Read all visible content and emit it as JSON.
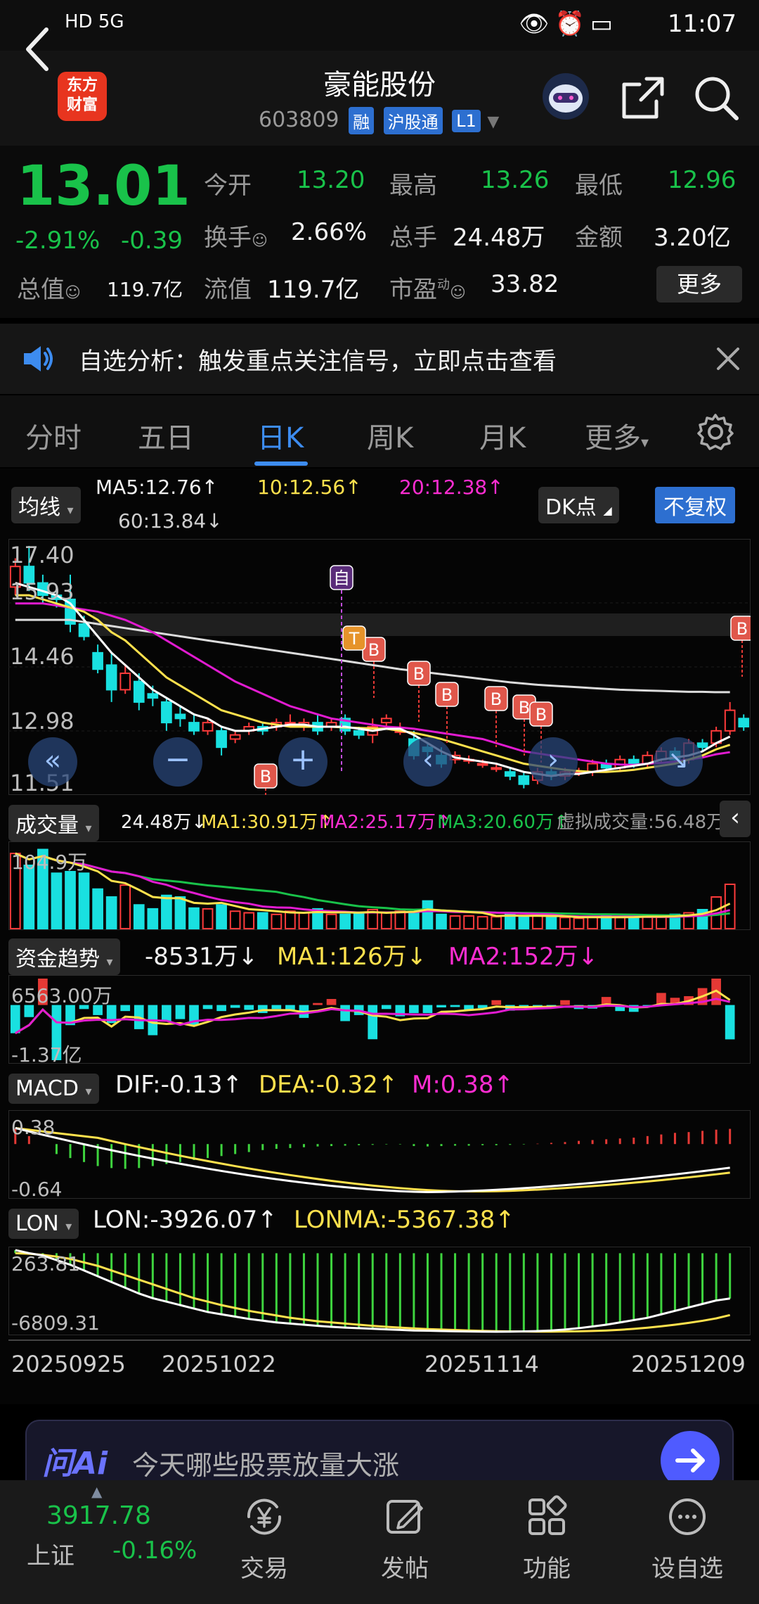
{
  "status_bar": {
    "left": "HD 5G",
    "time": "11:07"
  },
  "header": {
    "logo_line1": "东方",
    "logo_line2": "财富",
    "stock_name": "豪能股份",
    "stock_code": "603809",
    "tag_margin": "融",
    "tag_connect": "沪股通",
    "tag_level": "L1"
  },
  "quote": {
    "price": "13.01",
    "change_pct": "-2.91%",
    "change_amt": "-0.39",
    "open_label": "今开",
    "open": "13.20",
    "high_label": "最高",
    "high": "13.26",
    "low_label": "最低",
    "low": "12.96",
    "turnover_label": "换手",
    "turnover": "2.66%",
    "volume_label": "总手",
    "volume": "24.48万",
    "amount_label": "金额",
    "amount": "3.20亿",
    "mktcap_label": "总值",
    "mktcap": "119.7亿",
    "float_label": "流值",
    "float_cap": "119.7亿",
    "pe_label": "市盈",
    "pe_sup": "动",
    "pe": "33.82",
    "more_label": "更多"
  },
  "notice": {
    "text": "自选分析：触发重点关注信号，立即点击查看"
  },
  "tabs": [
    "分时",
    "五日",
    "日K",
    "周K",
    "月K",
    "更多"
  ],
  "active_tab": "日K",
  "ma_bar": {
    "selector": "均线",
    "ma5": "MA5:12.76↑",
    "ma10": "10:12.56↑",
    "ma20": "20:12.38↑",
    "ma60": "60:13.84↓",
    "dk_label": "DK点",
    "adjust_label": "不复权"
  },
  "price_axis": [
    "17.40",
    "15.93",
    "14.46",
    "12.98",
    "11.51"
  ],
  "markers": {
    "self": "自",
    "t": "T",
    "b": "B"
  },
  "volume_bar": {
    "selector": "成交量",
    "vol": "24.48万↓",
    "ma1": "MA1:30.91万↑",
    "ma2": "MA2:25.17万↑",
    "ma3": "MA3:20.60万↑",
    "virtual": "虚拟成交量:56.48万",
    "axis_top": "104.9万"
  },
  "fund_bar": {
    "selector": "资金趋势",
    "value": "-8531万↓",
    "ma1": "MA1:126万↓",
    "ma2": "MA2:152万↓",
    "axis_top": "6563.00万",
    "axis_bottom": "-1.37亿"
  },
  "macd_bar": {
    "selector": "MACD",
    "dif": "DIF:-0.13↑",
    "dea": "DEA:-0.32↑",
    "m": "M:0.38↑",
    "axis_top": "0.38",
    "axis_bottom": "-0.64"
  },
  "lon_bar": {
    "selector": "LON",
    "lon": "LON:-3926.07↑",
    "lonma": "LONMA:-5367.38↑",
    "axis_top": "263.81",
    "axis_bottom": "-6809.31"
  },
  "dates": [
    "20250925",
    "20251022",
    "20251114",
    "20251209"
  ],
  "ai_bar": {
    "logo": "问Ai",
    "prompt": "今天哪些股票放量大涨"
  },
  "bottom_nav": {
    "index_value": "3917.78",
    "index_name": "上证",
    "index_change": "-0.16%",
    "items": [
      "交易",
      "发帖",
      "功能",
      "设自选"
    ]
  },
  "chart_data": {
    "type": "candlestick",
    "ylim": [
      11.51,
      17.4
    ],
    "x_ticks": [
      "20250925",
      "20251022",
      "20251114",
      "20251209"
    ],
    "candles": [
      {
        "o": 16.4,
        "c": 16.9,
        "h": 17.1,
        "l": 16.2
      },
      {
        "o": 16.9,
        "c": 16.5,
        "h": 17.4,
        "l": 16.3
      },
      {
        "o": 16.5,
        "c": 16.2,
        "h": 16.7,
        "l": 16.0
      },
      {
        "o": 16.2,
        "c": 16.1,
        "h": 16.3,
        "l": 15.9
      },
      {
        "o": 16.1,
        "c": 15.5,
        "h": 16.7,
        "l": 15.3
      },
      {
        "o": 15.5,
        "c": 15.2,
        "h": 15.7,
        "l": 15.1
      },
      {
        "o": 14.8,
        "c": 14.4,
        "h": 15.0,
        "l": 14.3
      },
      {
        "o": 14.5,
        "c": 13.9,
        "h": 14.8,
        "l": 13.6
      },
      {
        "o": 13.9,
        "c": 14.3,
        "h": 14.5,
        "l": 13.8
      },
      {
        "o": 14.1,
        "c": 13.6,
        "h": 14.3,
        "l": 13.4
      },
      {
        "o": 13.8,
        "c": 13.7,
        "h": 14.0,
        "l": 13.5
      },
      {
        "o": 13.6,
        "c": 13.1,
        "h": 13.7,
        "l": 12.9
      },
      {
        "o": 13.3,
        "c": 13.2,
        "h": 13.5,
        "l": 13.0
      },
      {
        "o": 13.1,
        "c": 12.9,
        "h": 13.3,
        "l": 12.8
      },
      {
        "o": 12.9,
        "c": 13.1,
        "h": 13.2,
        "l": 12.8
      },
      {
        "o": 12.9,
        "c": 12.5,
        "h": 13.0,
        "l": 12.3
      },
      {
        "o": 12.7,
        "c": 12.8,
        "h": 12.9,
        "l": 12.6
      },
      {
        "o": 12.9,
        "c": 13.0,
        "h": 13.1,
        "l": 12.8
      },
      {
        "o": 13.0,
        "c": 12.9,
        "h": 13.1,
        "l": 12.8
      },
      {
        "o": 13.0,
        "c": 13.1,
        "h": 13.2,
        "l": 12.9
      },
      {
        "o": 13.1,
        "c": 13.1,
        "h": 13.3,
        "l": 13.0
      },
      {
        "o": 13.0,
        "c": 13.1,
        "h": 13.2,
        "l": 12.9
      },
      {
        "o": 13.1,
        "c": 12.9,
        "h": 13.3,
        "l": 12.8
      },
      {
        "o": 13.0,
        "c": 13.1,
        "h": 13.2,
        "l": 12.9
      },
      {
        "o": 13.2,
        "c": 12.9,
        "h": 13.3,
        "l": 12.8
      },
      {
        "o": 12.9,
        "c": 12.8,
        "h": 13.0,
        "l": 12.7
      },
      {
        "o": 12.8,
        "c": 13.0,
        "h": 13.2,
        "l": 12.6
      },
      {
        "o": 13.1,
        "c": 13.2,
        "h": 13.3,
        "l": 13.0
      },
      {
        "o": 12.9,
        "c": 12.9,
        "h": 13.1,
        "l": 12.8
      },
      {
        "o": 12.7,
        "c": 12.3,
        "h": 12.9,
        "l": 12.2
      },
      {
        "o": 12.5,
        "c": 12.4,
        "h": 12.6,
        "l": 12.2
      },
      {
        "o": 12.3,
        "c": 12.1,
        "h": 12.5,
        "l": 12.0
      },
      {
        "o": 12.2,
        "c": 12.3,
        "h": 12.4,
        "l": 12.1
      },
      {
        "o": 12.2,
        "c": 12.2,
        "h": 12.3,
        "l": 12.1
      },
      {
        "o": 12.1,
        "c": 12.1,
        "h": 12.2,
        "l": 12.0
      },
      {
        "o": 12.0,
        "c": 12.0,
        "h": 12.1,
        "l": 11.9
      },
      {
        "o": 11.9,
        "c": 11.8,
        "h": 12.0,
        "l": 11.7
      },
      {
        "o": 11.8,
        "c": 11.6,
        "h": 11.9,
        "l": 11.5
      },
      {
        "o": 11.7,
        "c": 11.9,
        "h": 12.0,
        "l": 11.6
      },
      {
        "o": 11.9,
        "c": 11.8,
        "h": 12.0,
        "l": 11.7
      },
      {
        "o": 11.8,
        "c": 11.9,
        "h": 12.0,
        "l": 11.7
      },
      {
        "o": 11.9,
        "c": 11.9,
        "h": 12.0,
        "l": 11.8
      },
      {
        "o": 11.9,
        "c": 12.1,
        "h": 12.2,
        "l": 11.8
      },
      {
        "o": 12.1,
        "c": 12.0,
        "h": 12.2,
        "l": 11.9
      },
      {
        "o": 12.0,
        "c": 12.2,
        "h": 12.3,
        "l": 11.9
      },
      {
        "o": 12.2,
        "c": 12.1,
        "h": 12.3,
        "l": 12.0
      },
      {
        "o": 12.1,
        "c": 12.3,
        "h": 12.4,
        "l": 12.0
      },
      {
        "o": 12.2,
        "c": 12.4,
        "h": 12.5,
        "l": 12.1
      },
      {
        "o": 12.4,
        "c": 12.2,
        "h": 12.5,
        "l": 12.1
      },
      {
        "o": 12.2,
        "c": 12.6,
        "h": 12.7,
        "l": 12.1
      },
      {
        "o": 12.6,
        "c": 12.5,
        "h": 12.7,
        "l": 12.4
      },
      {
        "o": 12.6,
        "c": 12.9,
        "h": 13.0,
        "l": 12.5
      },
      {
        "o": 12.9,
        "c": 13.4,
        "h": 13.6,
        "l": 12.8
      },
      {
        "o": 13.2,
        "c": 13.0,
        "h": 13.3,
        "l": 12.9
      }
    ],
    "ma5": [
      16.5,
      16.4,
      16.3,
      16.2,
      16.0,
      15.6,
      15.2,
      14.8,
      14.5,
      14.2,
      13.9,
      13.7,
      13.5,
      13.3,
      13.2,
      13.0,
      12.9,
      12.9,
      12.95,
      13.0,
      13.05,
      13.05,
      13.0,
      13.0,
      13.0,
      12.95,
      12.9,
      12.95,
      12.95,
      12.8,
      12.6,
      12.4,
      12.25,
      12.2,
      12.15,
      12.1,
      12.0,
      11.9,
      11.85,
      11.8,
      11.85,
      11.85,
      11.9,
      11.95,
      12.0,
      12.05,
      12.1,
      12.2,
      12.25,
      12.3,
      12.4,
      12.6,
      12.76
    ],
    "ma10": [
      16.2,
      16.2,
      16.1,
      16.0,
      15.9,
      15.8,
      15.6,
      15.3,
      15.1,
      14.8,
      14.5,
      14.2,
      14.0,
      13.8,
      13.6,
      13.4,
      13.3,
      13.2,
      13.1,
      13.05,
      13.0,
      13.0,
      13.0,
      13.0,
      12.98,
      12.97,
      12.96,
      12.95,
      12.9,
      12.85,
      12.78,
      12.7,
      12.6,
      12.5,
      12.4,
      12.3,
      12.2,
      12.1,
      12.05,
      12.0,
      11.95,
      11.92,
      11.9,
      11.9,
      11.92,
      11.95,
      12.0,
      12.05,
      12.1,
      12.2,
      12.3,
      12.45,
      12.56
    ],
    "ma20": [
      16.0,
      16.0,
      16.0,
      15.95,
      15.9,
      15.85,
      15.8,
      15.7,
      15.6,
      15.45,
      15.3,
      15.1,
      14.9,
      14.7,
      14.5,
      14.3,
      14.1,
      13.95,
      13.8,
      13.65,
      13.5,
      13.4,
      13.3,
      13.2,
      13.15,
      13.1,
      13.05,
      13.0,
      12.98,
      12.95,
      12.9,
      12.85,
      12.8,
      12.75,
      12.7,
      12.6,
      12.5,
      12.4,
      12.35,
      12.3,
      12.25,
      12.2,
      12.15,
      12.1,
      12.08,
      12.07,
      12.1,
      12.12,
      12.15,
      12.2,
      12.25,
      12.33,
      12.38
    ],
    "ma60": [
      15.6,
      15.6,
      15.6,
      15.6,
      15.6,
      15.55,
      15.5,
      15.45,
      15.4,
      15.35,
      15.3,
      15.25,
      15.2,
      15.15,
      15.1,
      15.05,
      15.0,
      14.95,
      14.9,
      14.85,
      14.8,
      14.75,
      14.7,
      14.65,
      14.6,
      14.55,
      14.5,
      14.45,
      14.4,
      14.36,
      14.32,
      14.28,
      14.24,
      14.2,
      14.16,
      14.12,
      14.08,
      14.05,
      14.02,
      14.0,
      13.98,
      13.96,
      13.94,
      13.92,
      13.9,
      13.89,
      13.88,
      13.87,
      13.86,
      13.85,
      13.85,
      13.84,
      13.84
    ],
    "volume": [
      95,
      80,
      100,
      70,
      72,
      70,
      50,
      40,
      55,
      30,
      25,
      42,
      40,
      26,
      25,
      30,
      22,
      20,
      20,
      18,
      22,
      20,
      25,
      18,
      18,
      20,
      24,
      20,
      22,
      20,
      35,
      18,
      16,
      16,
      15,
      15,
      20,
      15,
      16,
      14,
      14,
      13,
      15,
      16,
      14,
      15,
      16,
      15,
      18,
      20,
      24,
      40,
      56
    ],
    "fund_flow": [
      -7000,
      -3000,
      6563,
      -13700,
      -5000,
      -1000,
      -2500,
      -4500,
      -1500,
      -6000,
      -7500,
      -4000,
      -3500,
      -5000,
      -1000,
      -1500,
      -700,
      -1200,
      -2000,
      -1000,
      -1500,
      -3200,
      500,
      1500,
      -4000,
      -2500,
      -8500,
      -1000,
      -2800,
      -2000,
      -2000,
      -600,
      -500,
      -1200,
      -800,
      1200,
      -1400,
      -500,
      -800,
      -600,
      1200,
      -1000,
      -900,
      2000,
      -1500,
      -1700,
      -400,
      3000,
      1800,
      2200,
      4200,
      6563,
      -8531
    ],
    "macd_m": [
      0.38,
      0.2,
      0.0,
      -0.25,
      -0.35,
      -0.45,
      -0.55,
      -0.6,
      -0.62,
      -0.6,
      -0.55,
      -0.5,
      -0.45,
      -0.4,
      -0.35,
      -0.3,
      -0.25,
      -0.2,
      -0.15,
      -0.12,
      -0.1,
      -0.08,
      -0.06,
      -0.05,
      -0.04,
      -0.03,
      -0.02,
      -0.01,
      -0.01,
      -0.05,
      -0.06,
      -0.05,
      -0.04,
      -0.04,
      -0.03,
      -0.03,
      -0.02,
      -0.01,
      0.01,
      0.03,
      0.05,
      0.08,
      0.1,
      0.12,
      0.14,
      0.16,
      0.2,
      0.24,
      0.28,
      0.3,
      0.33,
      0.36,
      0.38
    ],
    "lon": [
      263,
      0,
      -200,
      -600,
      -1000,
      -1500,
      -2000,
      -2500,
      -3000,
      -3500,
      -3900,
      -4200,
      -4500,
      -4800,
      -5100,
      -5300,
      -5500,
      -5700,
      -5850,
      -6000,
      -6100,
      -6200,
      -6300,
      -6380,
      -6450,
      -6500,
      -6550,
      -6600,
      -6650,
      -6700,
      -6720,
      -6750,
      -6770,
      -6790,
      -6800,
      -6809,
      -6800,
      -6780,
      -6750,
      -6700,
      -6620,
      -6500,
      -6350,
      -6200,
      -6000,
      -5800,
      -5600,
      -5300,
      -5000,
      -4700,
      -4400,
      -4100,
      -3926
    ],
    "lonma": [
      0,
      -50,
      -150,
      -300,
      -500,
      -800,
      -1100,
      -1500,
      -1900,
      -2300,
      -2700,
      -3100,
      -3500,
      -3900,
      -4200,
      -4500,
      -4750,
      -5000,
      -5200,
      -5400,
      -5600,
      -5750,
      -5900,
      -6000,
      -6100,
      -6200,
      -6300,
      -6380,
      -6450,
      -6520,
      -6580,
      -6620,
      -6660,
      -6700,
      -6730,
      -6760,
      -6780,
      -6790,
      -6800,
      -6800,
      -6790,
      -6770,
      -6740,
      -6700,
      -6640,
      -6560,
      -6460,
      -6340,
      -6200,
      -6040,
      -5860,
      -5650,
      -5367
    ]
  }
}
